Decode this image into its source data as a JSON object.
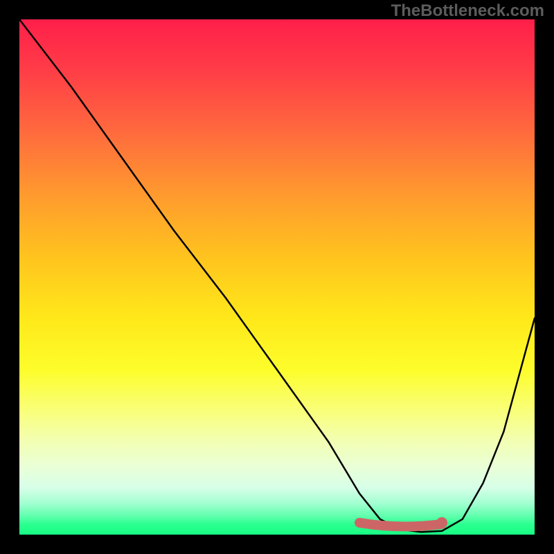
{
  "watermark": "TheBottleneck.com",
  "chart_data": {
    "type": "line",
    "title": "",
    "xlabel": "",
    "ylabel": "",
    "xlim": [
      0,
      100
    ],
    "ylim": [
      0,
      100
    ],
    "series": [
      {
        "name": "curve",
        "x": [
          0,
          10,
          20,
          30,
          40,
          50,
          60,
          66,
          70,
          74,
          78,
          82,
          86,
          90,
          94,
          100
        ],
        "values": [
          100,
          87,
          73,
          59,
          46,
          32,
          18,
          8,
          3,
          1,
          0.5,
          0.7,
          3,
          10,
          20,
          42
        ]
      }
    ],
    "flat_region": {
      "x_start": 66,
      "x_end": 82,
      "y": 1.5,
      "color": "#cc6666"
    },
    "flat_marker": {
      "x": 82,
      "y": 1.5,
      "color": "#cc6666"
    }
  }
}
